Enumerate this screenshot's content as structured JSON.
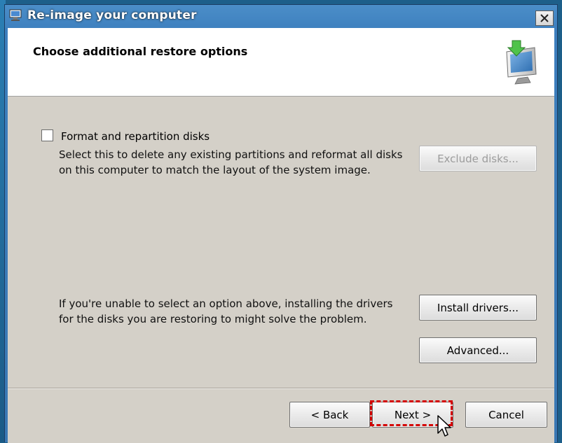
{
  "window": {
    "title": "Re-image your computer",
    "close_symbol": "✕"
  },
  "header": {
    "title": "Choose additional restore options",
    "icon": "computer-restore-icon"
  },
  "format_option": {
    "label": "Format and repartition disks",
    "checked": false,
    "description_line1": "Select this to delete any existing partitions and reformat all disks",
    "description_line2": "on this computer to match the layout of the system image.",
    "exclude_button": "Exclude disks..."
  },
  "drivers": {
    "description_line1": "If you're unable to select an option above, installing the drivers",
    "description_line2": "for the disks you are restoring to might solve the problem.",
    "install_button": "Install drivers...",
    "advanced_button": "Advanced..."
  },
  "footer": {
    "back_button": "< Back",
    "next_button": "Next >",
    "cancel_button": "Cancel"
  },
  "colors": {
    "dialog_bg": "#d4d0c8",
    "titlebar": "#3d7fbe",
    "highlight": "#d40000"
  }
}
